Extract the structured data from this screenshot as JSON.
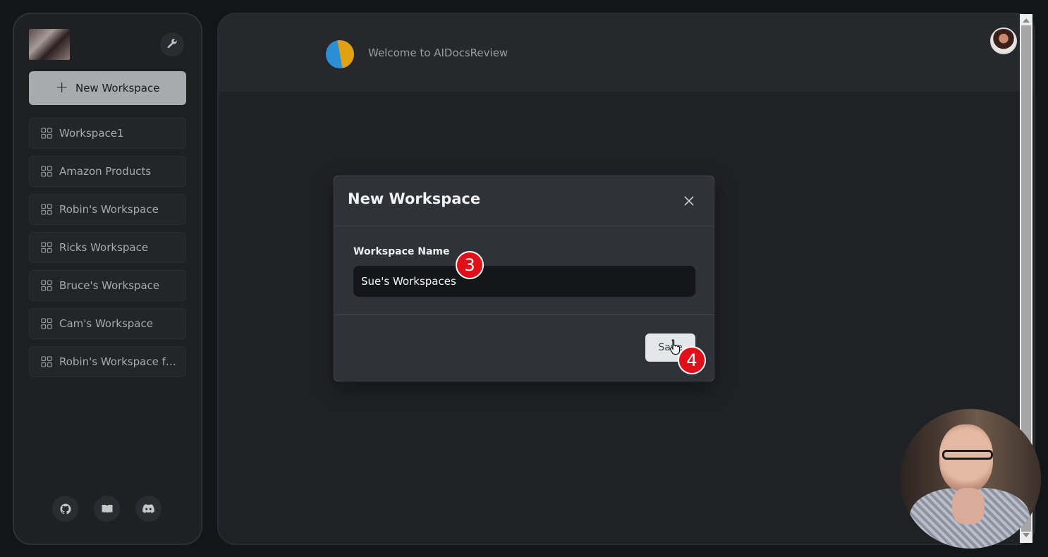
{
  "sidebar": {
    "new_workspace_label": "New Workspace",
    "workspaces": [
      {
        "label": "Workspace1"
      },
      {
        "label": "Amazon Products"
      },
      {
        "label": "Robin's Workspace"
      },
      {
        "label": "Ricks Workspace"
      },
      {
        "label": "Bruce's Workspace"
      },
      {
        "label": "Cam's Workspace"
      },
      {
        "label": "Robin's Workspace fo..."
      }
    ],
    "footer_icons": [
      "github-icon",
      "book-icon",
      "discord-icon"
    ]
  },
  "header": {
    "welcome_text": "Welcome to AIDocsReview"
  },
  "modal": {
    "title": "New Workspace",
    "field_label": "Workspace Name",
    "input_value": "Sue's Workspaces",
    "save_label": "Save"
  },
  "annotations": {
    "step_3": "3",
    "step_4": "4"
  },
  "colors": {
    "background": "#141517",
    "sidebar_bg": "#1e2022",
    "modal_bg": "#2f3236",
    "input_bg": "#151618",
    "badge_red": "#e0101a",
    "primary_button": "#a9aaad"
  }
}
